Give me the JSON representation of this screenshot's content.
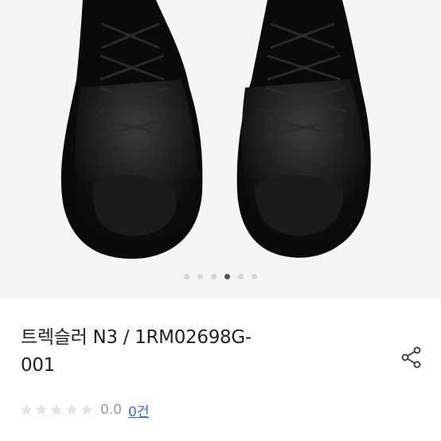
{
  "carousel": {
    "slides": [
      "slide-1",
      "slide-2",
      "slide-3",
      "slide-4",
      "slide-5",
      "slide-6"
    ],
    "active_index": 3
  },
  "product": {
    "title_line1": "트렉슬러 N3 / 1RM02698G-",
    "title_line2": "001"
  },
  "rating": {
    "stars_filled": 0,
    "stars_total": 5,
    "score": "0.0",
    "review_count": "0건"
  },
  "icons": {
    "share": "share-icon",
    "star": "star-icon"
  },
  "colors": {
    "gallery_bg": "#f5f5f5",
    "dot_active": "#555555",
    "dot_inactive": "#d6d6d6",
    "link": "#3d6bd9",
    "star_empty": "#e3e3e3"
  }
}
